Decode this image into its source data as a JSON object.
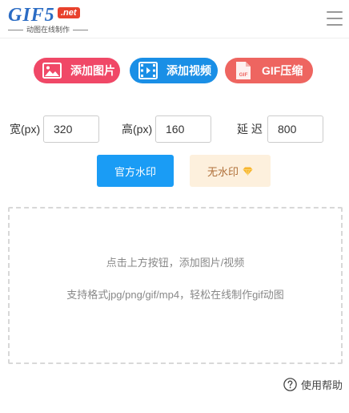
{
  "header": {
    "logo_main": "GIF5",
    "logo_badge": ".net",
    "logo_subtitle": "动图在线制作"
  },
  "toolbar": {
    "add_image": "添加图片",
    "add_video": "添加视频",
    "gif_compress": "GIF压缩",
    "gif_file_icon_text": "GIF"
  },
  "params": {
    "width_label": "宽(px)",
    "width_value": "320",
    "height_label": "高(px)",
    "height_value": "160",
    "delay_label": "延 迟",
    "delay_value": "800"
  },
  "watermark": {
    "official": "官方水印",
    "none": "无水印"
  },
  "dropzone": {
    "line1": "点击上方按钮，添加图片/视频",
    "line2": "支持格式jpg/png/gif/mp4，轻松在线制作gif动图"
  },
  "help": {
    "label": "使用帮助"
  },
  "colors": {
    "add_image_bg": "#f04867",
    "add_video_bg": "#1a8fe6",
    "gif_compress_bg": "#ee6560",
    "official_watermark_bg": "#1a9cf5",
    "no_watermark_bg": "#fdf0dd",
    "logo_blue": "#2b6cc4",
    "logo_badge_red": "#e8412c"
  },
  "icons": [
    "image-icon",
    "film-icon",
    "gif-file-icon",
    "diamond-icon",
    "help-circle-icon",
    "hamburger-menu-icon"
  ]
}
